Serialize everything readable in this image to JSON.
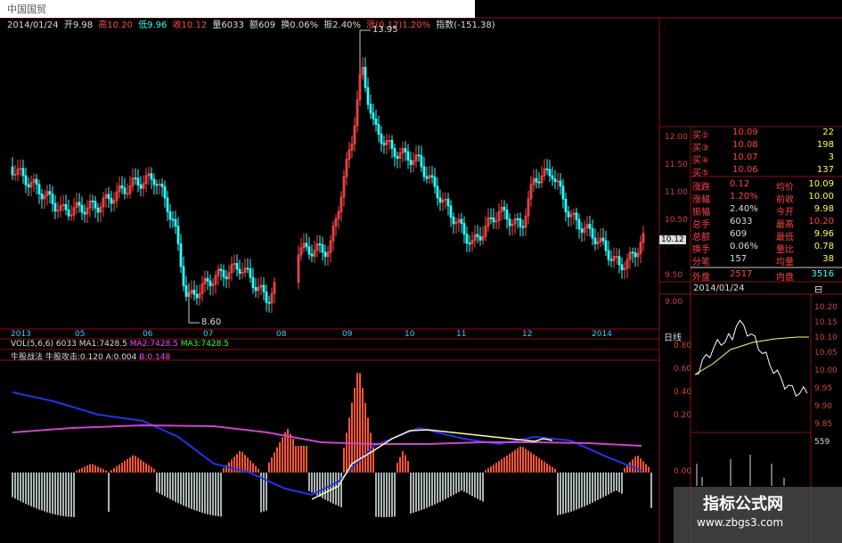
{
  "window_title": "中国国贸",
  "info_bar": {
    "date": "2014/01/24",
    "open": "开9.98",
    "high": "高10.20",
    "low": "低9.96",
    "close": "收10.12",
    "volume": "量6033",
    "amount": "额609",
    "turnover": "换0.06%",
    "amplitude": "振2.40%",
    "change": "涨(0.12)1.20%",
    "index": "指数(-151.38)"
  },
  "price_axis": [
    "12.00",
    "11.50",
    "11.00",
    "10.50",
    "10.00",
    "9.50",
    "9.00"
  ],
  "current_price_tag": "10.12",
  "peak_label": "13.95",
  "low_label": "8.60",
  "period_label": "日线",
  "time_axis": [
    "2013",
    "05",
    "06",
    "07",
    "08",
    "09",
    "10",
    "11",
    "12",
    "2014"
  ],
  "vol_legend": {
    "name": "VOL(5,6,6)",
    "val": "6033",
    "ma1": "MA1:7428.5",
    "ma2": "MA2:7428.5",
    "ma3": "MA3:7428.5"
  },
  "indicator_legend": {
    "name": "牛股战法",
    "attack": "牛股攻击:0.120",
    "a": "A:0.004",
    "b": "B:0.148"
  },
  "order_book": [
    {
      "label": "买②",
      "price": "10.09",
      "vol": "22"
    },
    {
      "label": "买③",
      "price": "10.08",
      "vol": "198"
    },
    {
      "label": "买④",
      "price": "10.07",
      "vol": "3"
    },
    {
      "label": "买⑤",
      "price": "10.06",
      "vol": "137"
    }
  ],
  "stats": [
    {
      "l1": "涨跌",
      "v1": "0.12",
      "l2": "均价",
      "v2": "10.09"
    },
    {
      "l1": "涨幅",
      "v1": "1.20%",
      "l2": "前收",
      "v2": "10.00"
    },
    {
      "l1": "振幅",
      "v1": "2.40%",
      "l2": "今开",
      "v2": "9.98"
    },
    {
      "l1": "总手",
      "v1": "6033",
      "l2": "最高",
      "v2": "10.20"
    },
    {
      "l1": "总额",
      "v1": "609",
      "l2": "最低",
      "v2": "9.96"
    },
    {
      "l1": "换手",
      "v1": "0.06%",
      "l2": "量比",
      "v2": "0.78"
    },
    {
      "l1": "分笔",
      "v1": "157",
      "l2": "均量",
      "v2": "38"
    },
    {
      "l1": "外盘",
      "v1": "2517",
      "l2": "内盘",
      "v2": "3516"
    }
  ],
  "intraday": {
    "date": "2014/01/24",
    "right_axis": [
      "10.20",
      "10.15",
      "10.10",
      "10.05",
      "10.00",
      "9.95",
      "9.90",
      "9.85"
    ],
    "left_axis": [
      "0.80",
      "0.60",
      "0.40",
      "0.20",
      "0.00"
    ],
    "vol_max": "559",
    "vol_zero": "0.00"
  },
  "watermark": {
    "title": "指标公式网",
    "url": "www.zbgs3.com"
  },
  "colors": {
    "up": "#ff4a4a",
    "down": "#33ffff",
    "grid": "#8a1010",
    "bull_bar": "#ff5533",
    "bear_bar": "#a9b4b4"
  }
}
